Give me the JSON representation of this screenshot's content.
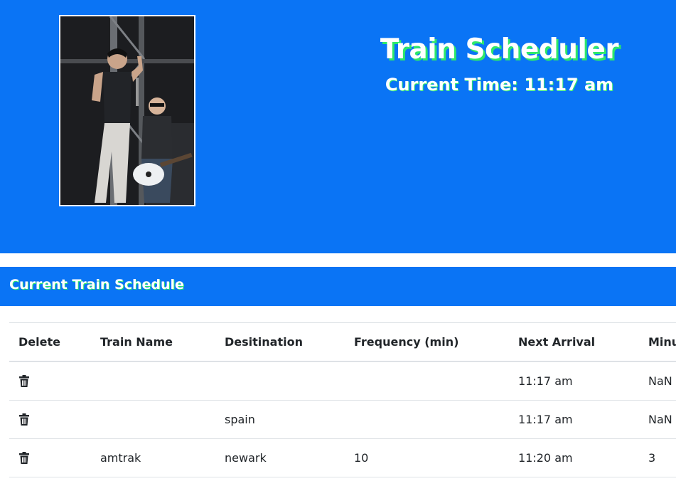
{
  "header": {
    "title": "Train Scheduler",
    "current_time_label": "Current Time: 11:17 am"
  },
  "schedule": {
    "heading": "Current Train Schedule",
    "columns": [
      "Delete",
      "Train Name",
      "Desitination",
      "Frequency (min)",
      "Next Arrival",
      "Minu"
    ],
    "rows": [
      {
        "name": "",
        "destination": "",
        "frequency": "",
        "next_arrival": "11:17 am",
        "minutes_away": "NaN"
      },
      {
        "name": "",
        "destination": "spain",
        "frequency": "",
        "next_arrival": "11:17 am",
        "minutes_away": "NaN"
      },
      {
        "name": "amtrak",
        "destination": "newark",
        "frequency": "10",
        "next_arrival": "11:20 am",
        "minutes_away": "3"
      }
    ]
  },
  "icons": {
    "delete": "trash-icon",
    "photo": "band-photo"
  },
  "colors": {
    "primary": "#0a74f5",
    "title_shadow": "#2ee86a",
    "text": "#212529",
    "border": "#dee2e6"
  }
}
